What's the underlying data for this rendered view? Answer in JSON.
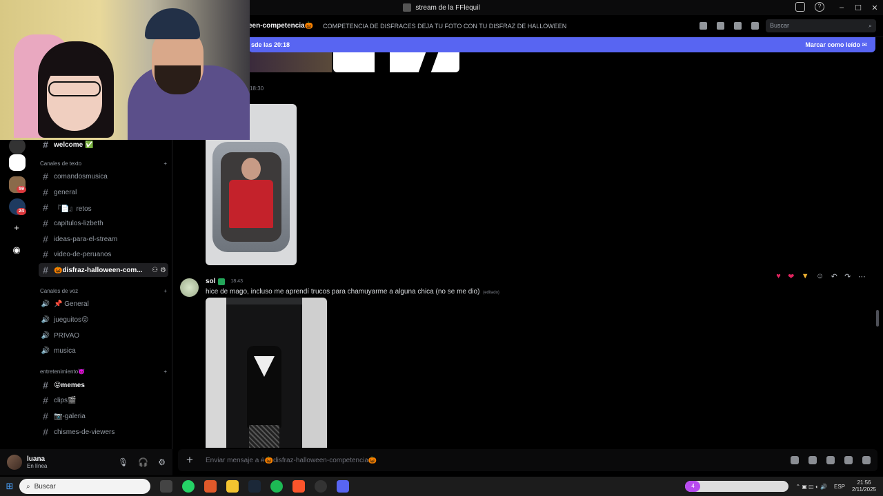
{
  "window": {
    "title": "stream de la FFlequil"
  },
  "header": {
    "channel": "een-competencia🎃",
    "topic": "COMPETENCIA DE DISFRACES DEJA TU FOTO CON TU DISFRAZ DE HALLOWEEN",
    "search_placeholder": "Buscar"
  },
  "banner": {
    "left": "sde las 20:18",
    "right": "Marcar como leído"
  },
  "rail": {
    "badge_1": "59",
    "badge_2": "24"
  },
  "sidebar": {
    "top_channel": "welcome ✅",
    "cat_text": "Canales de texto",
    "text_channels": [
      "comandosmusica",
      "general",
      "『📄』retos",
      "capitulos-lizbeth",
      "ideas-para-el-stream",
      "video-de-peruanos",
      "🎃disfraz-halloween-com..."
    ],
    "cat_voice": "Canales de voz",
    "voice_channels": [
      "📌 General",
      "jueguitos😜",
      "PRIVAO",
      "musica"
    ],
    "cat_ent": "entretenimiento👿",
    "ent_channels": [
      "😝memes",
      "clips🎬",
      "📷-galeria",
      "chismes-de-viewers"
    ]
  },
  "user": {
    "name": "luana",
    "status": "En línea"
  },
  "messages": {
    "prev_time": "18:30",
    "author": "sol",
    "time": "18:43",
    "text": "hice de mago, incluso me aprendí trucos para chamuyarme a alguna chica (no se me dio)",
    "edited": "(editado)"
  },
  "composer": {
    "placeholder": "Enviar mensaje a #🎃disfraz-halloween-competencia🎃"
  },
  "taskbar": {
    "search": "Buscar",
    "lang": "ESP",
    "time": "21:56",
    "date": "2/11/2025",
    "pill_count": "4"
  }
}
